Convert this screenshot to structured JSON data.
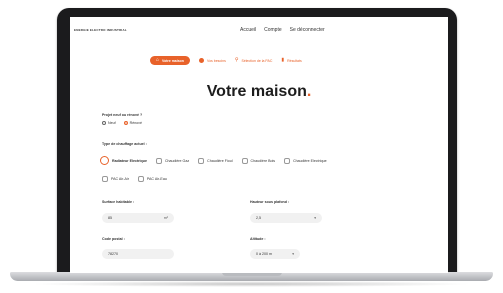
{
  "header": {
    "brand": "ENERGIE ELECTRO INDUSTRIAL",
    "nav": [
      "Accueil",
      "Compte",
      "Se déconnecter"
    ]
  },
  "steps": [
    {
      "label": "Votre maison",
      "active": true
    },
    {
      "label": "Vos besoins",
      "active": false
    },
    {
      "label": "Sélection de la PAC",
      "active": false
    },
    {
      "label": "Résultats",
      "active": false
    }
  ],
  "page": {
    "title": "Votre maison",
    "title_dot": "."
  },
  "project": {
    "label": "Projet neuf ou rénové ?",
    "options": [
      "Neuf",
      "Rénové"
    ],
    "selected": "Rénové"
  },
  "heating": {
    "label": "Type de chauffage actuel :",
    "options": [
      "Radiateur Electrique",
      "Chaudière Gaz",
      "Chaudière Fioul",
      "Chaudière Bois",
      "Chaudière Electrique",
      "PAC Air-Air",
      "PAC Air-Eau"
    ],
    "selected": "Radiateur Electrique"
  },
  "surface": {
    "label": "Surface habitable :",
    "value": "85",
    "unit": "m²"
  },
  "height": {
    "label": "Hauteur sous plafond :",
    "value": "2,5"
  },
  "postal": {
    "label": "Code postal :",
    "value": "78270"
  },
  "altitude": {
    "label": "Altitude :",
    "value": "0 à 200 m"
  },
  "colors": {
    "accent": "#e8622a",
    "frame": "#1b1b1d"
  }
}
